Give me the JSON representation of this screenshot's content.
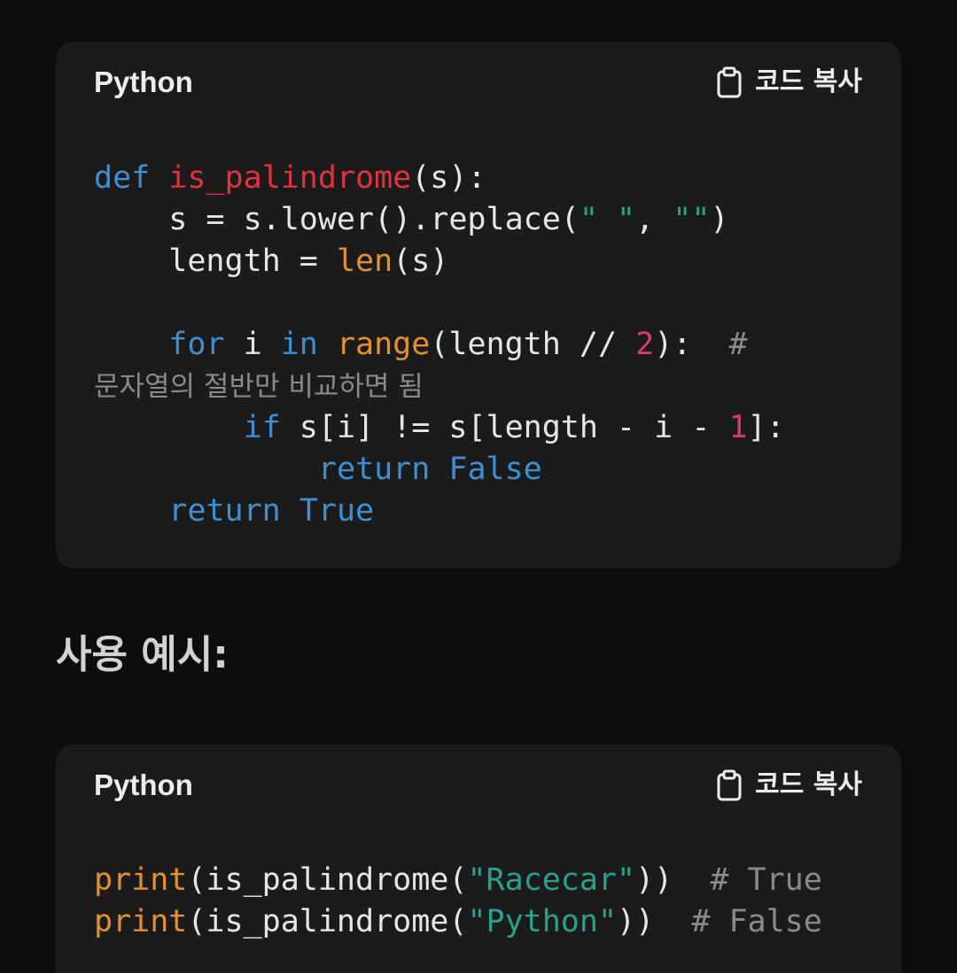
{
  "blocks": [
    {
      "language": "Python",
      "copy_label": "코드 복사",
      "lines": {
        "l1": {
          "a": "def",
          "b": " ",
          "c": "is_palindrome",
          "d": "(s):"
        },
        "l2": {
          "a": "    s = s.lower().replace(",
          "b": "\" \"",
          "c": ", ",
          "d": "\"\"",
          "e": ")"
        },
        "l3": {
          "a": "    length = ",
          "b": "len",
          "c": "(s)"
        },
        "l5": {
          "a": "    ",
          "b": "for",
          "c": " i ",
          "d": "in",
          "e": " ",
          "f": "range",
          "g": "(length // ",
          "h": "2",
          "i": "):  ",
          "j": "#"
        },
        "l6": {
          "a": "문자열의 절반만 비교하면 됨"
        },
        "l7": {
          "a": "        ",
          "b": "if",
          "c": " s[i] != s[length - i - ",
          "d": "1",
          "e": "]:"
        },
        "l8": {
          "a": "            ",
          "b": "return",
          "c": " ",
          "d": "False"
        },
        "l9": {
          "a": "    ",
          "b": "return",
          "c": " ",
          "d": "True"
        }
      }
    },
    {
      "language": "Python",
      "copy_label": "코드 복사",
      "lines": {
        "l1": {
          "a": "print",
          "b": "(is_palindrome(",
          "c": "\"Racecar\"",
          "d": "))  ",
          "e": "# True"
        },
        "l2": {
          "a": "print",
          "b": "(is_palindrome(",
          "c": "\"Python\"",
          "d": "))  ",
          "e": "# False"
        }
      }
    }
  ],
  "section_heading": "사용 예시:",
  "icons": {
    "copy": "clipboard-icon"
  },
  "colors": {
    "background": "#0d0d0d",
    "block_background": "#1b1b1b",
    "keyword": "#3d8fd1",
    "function_name": "#e0323f",
    "builtin": "#e1922e",
    "string": "#2aa187",
    "number": "#d63a74",
    "comment": "#8a8a8a"
  }
}
